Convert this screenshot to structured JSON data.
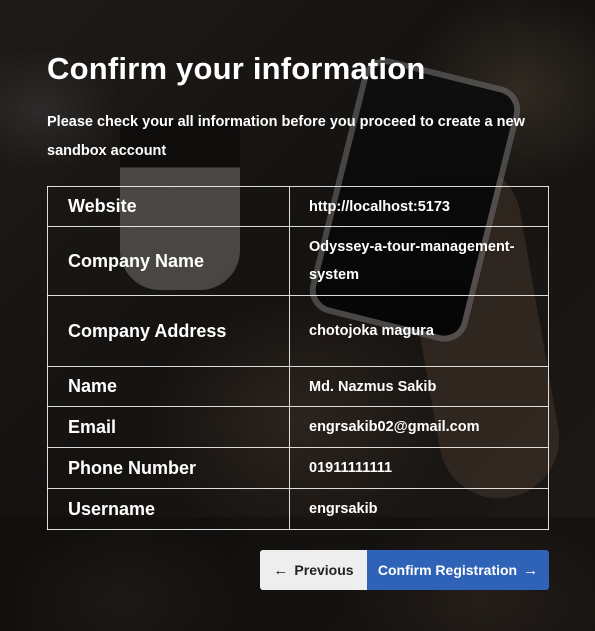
{
  "page": {
    "title": "Confirm your information",
    "subtitle": "Please check your all information before you proceed to create a new sandbox account"
  },
  "table": {
    "rows": [
      {
        "label": "Website",
        "value": "http://localhost:5173"
      },
      {
        "label": "Company Name",
        "value": "Odyssey-a-tour-management-system"
      },
      {
        "label": "Company Address",
        "value": "chotojoka magura"
      },
      {
        "label": "Name",
        "value": "Md. Nazmus Sakib"
      },
      {
        "label": "Email",
        "value": "engrsakib02@gmail.com"
      },
      {
        "label": "Phone Number",
        "value": "01911111111"
      },
      {
        "label": "Username",
        "value": "engrsakib"
      }
    ]
  },
  "buttons": {
    "previous": {
      "label": "Previous",
      "icon": "arrow-left-icon",
      "glyph": "←"
    },
    "confirm": {
      "label": "Confirm Registration",
      "icon": "arrow-right-icon",
      "glyph": "→",
      "color": "#2f63b7"
    }
  }
}
